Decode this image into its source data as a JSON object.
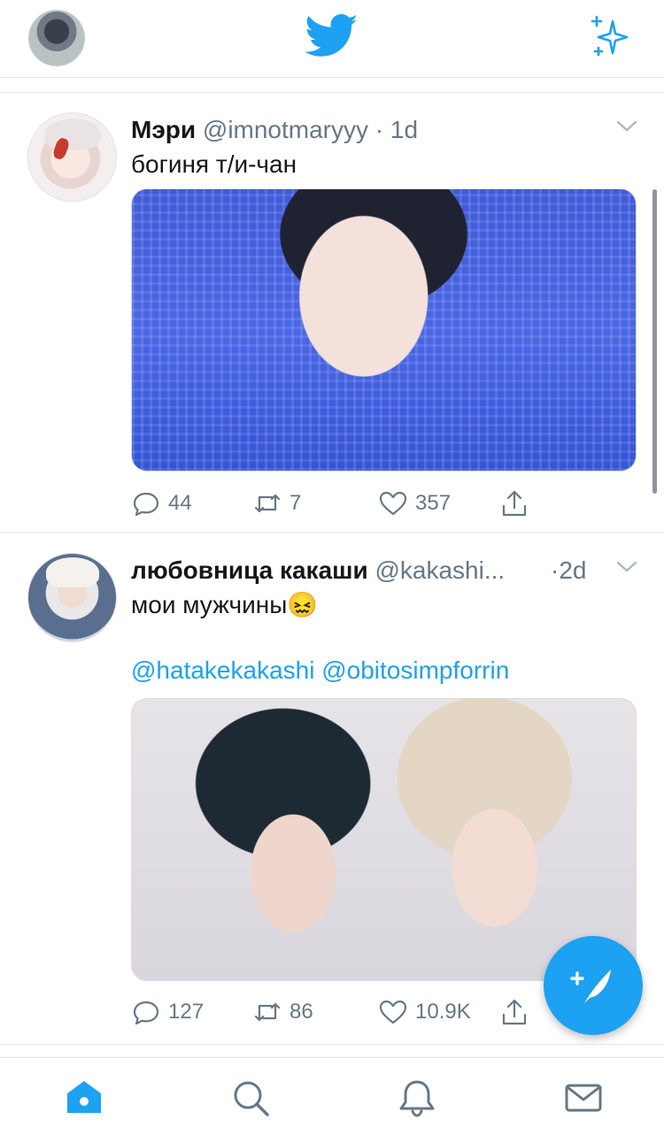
{
  "app": {
    "name": "Twitter"
  },
  "header": {
    "avatar_icon": "profile-avatar",
    "logo_icon": "twitter-bird-icon",
    "sparkle_icon": "sparkle-icon"
  },
  "tweets": [
    {
      "name": "Мэри",
      "handle": "@imnotmaryyy",
      "separator": "·",
      "time": "1d",
      "text": "богиня т/и-чан",
      "mentions": [],
      "media_alt": "photo",
      "stats": {
        "replies": "44",
        "retweets": "7",
        "likes": "357"
      }
    },
    {
      "name": "любовница какаши",
      "handle": "@kakashi...",
      "separator": "·",
      "time": "2d",
      "text": "мои мужчины😖",
      "mentions": [
        "@hatakekakashi",
        "@obitosimpforrin"
      ],
      "media_alt": "photo",
      "stats": {
        "replies": "127",
        "retweets": "86",
        "likes": "10.9K"
      }
    }
  ],
  "colors": {
    "accent": "#1da1f2",
    "text": "#14171a",
    "secondary": "#657786"
  },
  "bottom_nav": [
    "home-icon",
    "search-icon",
    "notifications-icon",
    "messages-icon"
  ]
}
